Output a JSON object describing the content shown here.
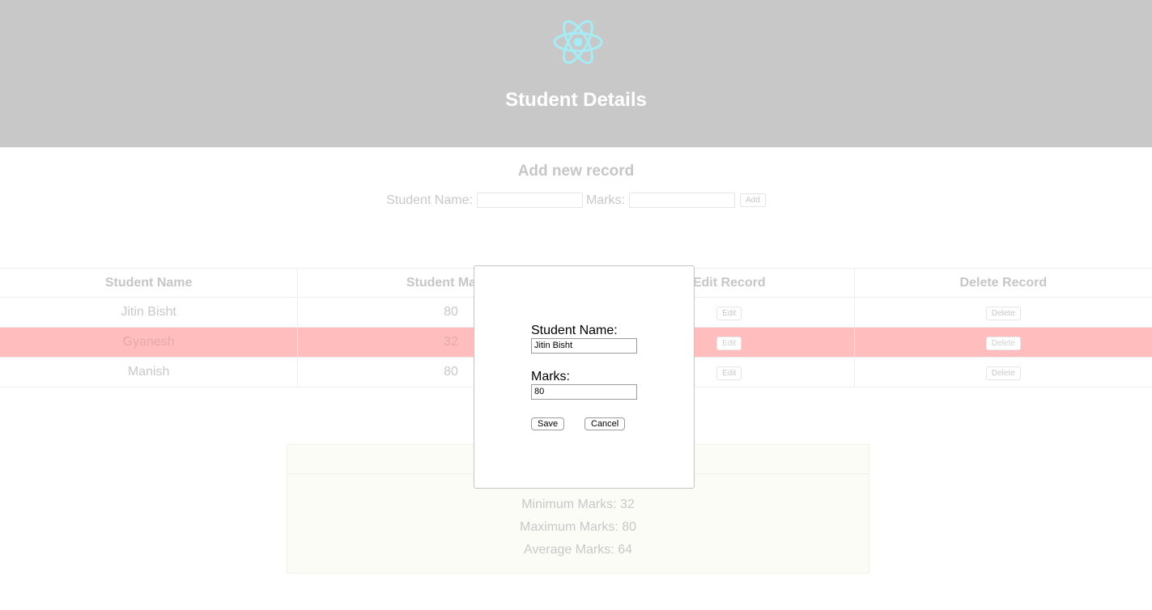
{
  "header": {
    "logo_icon": "react-atom-icon",
    "logo_color": "#a6ecf7",
    "title": "Student Details"
  },
  "add_record": {
    "title": "Add new record",
    "name_label": "Student Name:",
    "marks_label": "Marks:",
    "name_value": "",
    "marks_value": "",
    "add_label": "Add"
  },
  "table": {
    "headers": [
      "Student Name",
      "Student Marks",
      "Edit Record",
      "Delete Record"
    ],
    "rows": [
      {
        "name": "Jitin Bisht",
        "marks": "80",
        "edit_label": "Edit",
        "delete_label": "Delete",
        "highlighted": false
      },
      {
        "name": "Gyanesh",
        "marks": "32",
        "edit_label": "Edit",
        "delete_label": "Delete",
        "highlighted": true
      },
      {
        "name": "Manish",
        "marks": "80",
        "edit_label": "Edit",
        "delete_label": "Delete",
        "highlighted": false
      }
    ],
    "highlight_color": "#ffbdbd"
  },
  "stats": {
    "min": "Minimum Marks: 32",
    "max": "Maximum Marks: 80",
    "avg": "Average Marks: 64"
  },
  "edit_modal": {
    "name_label": "Student Name:",
    "name_value": "Jitin Bisht",
    "marks_label": "Marks:",
    "marks_value": "80",
    "save_label": "Save",
    "cancel_label": "Cancel"
  }
}
